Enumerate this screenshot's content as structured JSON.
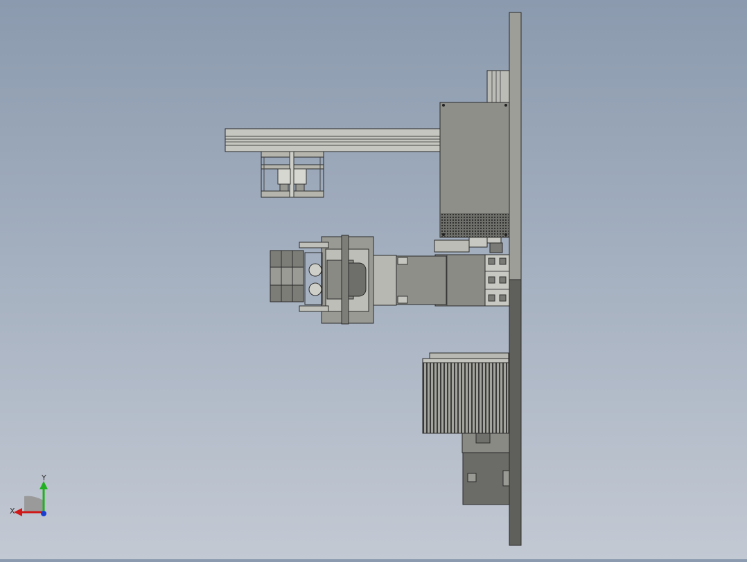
{
  "triad": {
    "x_label": "X",
    "y_label": "Y",
    "colors": {
      "x": "#d01818",
      "y": "#22b022",
      "z": "#1a3fd0",
      "cap": "#9a9a9a"
    }
  },
  "model": {
    "colors": {
      "background_top": "#8b9aae",
      "background_bottom": "#c3c9d3",
      "part_light": "#bdbdbd",
      "part_mid": "#a2a29c",
      "part_body": "#8c8c86",
      "part_dark": "#5e5e5a",
      "outline": "#2a2a2a"
    }
  }
}
